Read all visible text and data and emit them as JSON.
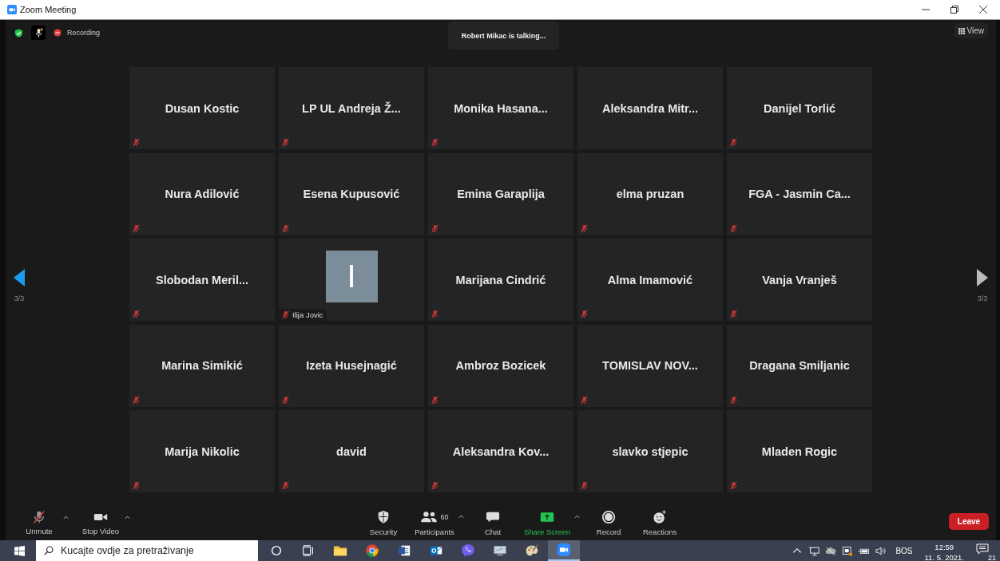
{
  "window": {
    "title": "Zoom Meeting"
  },
  "top_bar": {
    "recording_label": "Recording",
    "talking": "Robert Mikac is talking...",
    "view_button": "View"
  },
  "pager": {
    "left": {
      "label": "3/3",
      "active": true
    },
    "right": {
      "label": "3/3",
      "active": false
    }
  },
  "tiles": [
    {
      "kind": "name",
      "name": "Dusan Kostic",
      "muted": true
    },
    {
      "kind": "name",
      "name": "LP UL Andreja Ž...",
      "muted": true
    },
    {
      "kind": "name",
      "name": "Monika  Hasana...",
      "muted": true
    },
    {
      "kind": "name",
      "name": "Aleksandra  Mitr...",
      "muted": false
    },
    {
      "kind": "name",
      "name": "Danijel Torlić",
      "muted": true
    },
    {
      "kind": "name",
      "name": "Nura Adilović",
      "muted": true
    },
    {
      "kind": "name",
      "name": "Esena Kupusović",
      "muted": true
    },
    {
      "kind": "name",
      "name": "Emina Garaplija",
      "muted": true
    },
    {
      "kind": "name",
      "name": "elma pruzan",
      "muted": true
    },
    {
      "kind": "name",
      "name": "FGA - Jasmin Ca...",
      "muted": true
    },
    {
      "kind": "name",
      "name": "Slobodan  Meril...",
      "muted": true
    },
    {
      "kind": "avatar",
      "initial": "I",
      "name": "Ilija Jovic",
      "muted": true
    },
    {
      "kind": "name",
      "name": "Marijana Cindrić",
      "muted": true
    },
    {
      "kind": "name",
      "name": "Alma Imamović",
      "muted": true
    },
    {
      "kind": "name",
      "name": "Vanja Vranješ",
      "muted": true
    },
    {
      "kind": "name",
      "name": "Marina Simikić",
      "muted": true
    },
    {
      "kind": "name",
      "name": "Izeta Husejnagić",
      "muted": true
    },
    {
      "kind": "name",
      "name": "Ambroz Bozicek",
      "muted": true
    },
    {
      "kind": "name",
      "name": "TOMISLAV  NOV...",
      "muted": true
    },
    {
      "kind": "name",
      "name": "Dragana Smiljanic",
      "muted": true
    },
    {
      "kind": "name",
      "name": "Marija Nikolic",
      "muted": true
    },
    {
      "kind": "name",
      "name": "david",
      "muted": true
    },
    {
      "kind": "name",
      "name": "Aleksandra  Kov...",
      "muted": true
    },
    {
      "kind": "name",
      "name": "slavko stjepic",
      "muted": true
    },
    {
      "kind": "name",
      "name": "Mladen Rogic",
      "muted": true
    }
  ],
  "toolbar": {
    "left": [
      {
        "kind": "unmute",
        "label": "Unmute"
      },
      {
        "kind": "video",
        "label": "Stop Video"
      }
    ],
    "center": [
      {
        "kind": "security",
        "label": "Security"
      },
      {
        "kind": "participants",
        "label": "Participants",
        "count": "60"
      },
      {
        "kind": "chat",
        "label": "Chat"
      },
      {
        "kind": "share",
        "label": "Share Screen"
      },
      {
        "kind": "record",
        "label": "Record"
      },
      {
        "kind": "reactions",
        "label": "Reactions"
      }
    ],
    "leave": "Leave"
  },
  "taskbar": {
    "search_placeholder": "Kucajte ovdje za pretraživanje",
    "apps": [
      {
        "kind": "cortana",
        "selected": false
      },
      {
        "kind": "taskview",
        "selected": false
      },
      {
        "kind": "folder",
        "selected": false
      },
      {
        "kind": "chrome",
        "selected": false
      },
      {
        "kind": "word",
        "selected": false
      },
      {
        "kind": "outlook",
        "selected": false
      },
      {
        "kind": "viber",
        "selected": false
      },
      {
        "kind": "monitor",
        "selected": false
      },
      {
        "kind": "paint",
        "selected": false
      },
      {
        "kind": "zoom",
        "selected": true
      }
    ],
    "language": "BOS",
    "time": "12:59",
    "date": "11. 5. 2021.",
    "notifications": "21"
  }
}
